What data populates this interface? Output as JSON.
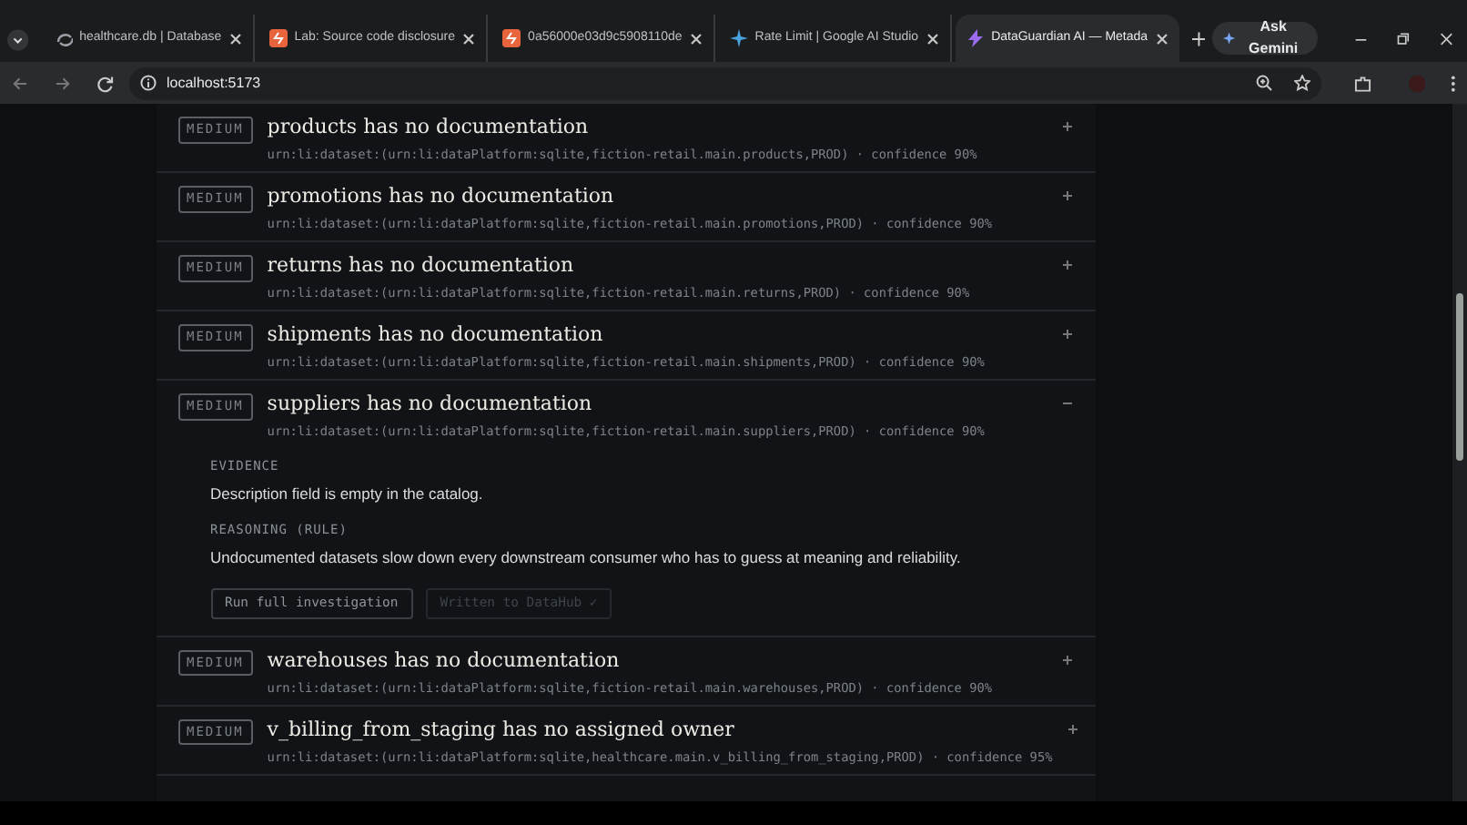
{
  "browser": {
    "tabs": [
      {
        "title": "healthcare.db | Database",
        "selected": false
      },
      {
        "title": "Lab: Source code disclosure",
        "selected": false
      },
      {
        "title": "0a56000e03d9c5908110de",
        "selected": false
      },
      {
        "title": "Rate Limit | Google AI Studio",
        "selected": false
      },
      {
        "title": "DataGuardian AI — Metada",
        "selected": true
      }
    ],
    "ask_button": "Ask Gemini",
    "address": "localhost:5173"
  },
  "findings": [
    {
      "severity": "MEDIUM",
      "title": "products has no documentation",
      "detail": "urn:li:dataset:(urn:li:dataPlatform:sqlite,fiction-retail.main.products,PROD) · confidence 90%",
      "expanded": false
    },
    {
      "severity": "MEDIUM",
      "title": "promotions has no documentation",
      "detail": "urn:li:dataset:(urn:li:dataPlatform:sqlite,fiction-retail.main.promotions,PROD) · confidence 90%",
      "expanded": false
    },
    {
      "severity": "MEDIUM",
      "title": "returns has no documentation",
      "detail": "urn:li:dataset:(urn:li:dataPlatform:sqlite,fiction-retail.main.returns,PROD) · confidence 90%",
      "expanded": false
    },
    {
      "severity": "MEDIUM",
      "title": "shipments has no documentation",
      "detail": "urn:li:dataset:(urn:li:dataPlatform:sqlite,fiction-retail.main.shipments,PROD) · confidence 90%",
      "expanded": false
    },
    {
      "severity": "MEDIUM",
      "title": "suppliers has no documentation",
      "detail": "urn:li:dataset:(urn:li:dataPlatform:sqlite,fiction-retail.main.suppliers,PROD) · confidence 90%",
      "expanded": true,
      "evidence_label": "EVIDENCE",
      "evidence": "Description field is empty in the catalog.",
      "reasoning_label": "REASONING (RULE)",
      "reasoning": "Undocumented datasets slow down every downstream consumer who has to guess at meaning and reliability.",
      "actions": [
        {
          "label": "Run full investigation",
          "disabled": false
        },
        {
          "label": "Written to DataHub ✓",
          "disabled": true
        }
      ]
    },
    {
      "severity": "MEDIUM",
      "title": "warehouses has no documentation",
      "detail": "urn:li:dataset:(urn:li:dataPlatform:sqlite,fiction-retail.main.warehouses,PROD) · confidence 90%",
      "expanded": false
    },
    {
      "severity": "MEDIUM",
      "title": "v_billing_from_staging has no assigned owner",
      "detail": "urn:li:dataset:(urn:li:dataPlatform:sqlite,healthcare.main.v_billing_from_staging,PROD) · confidence 95%",
      "expanded": false
    }
  ]
}
